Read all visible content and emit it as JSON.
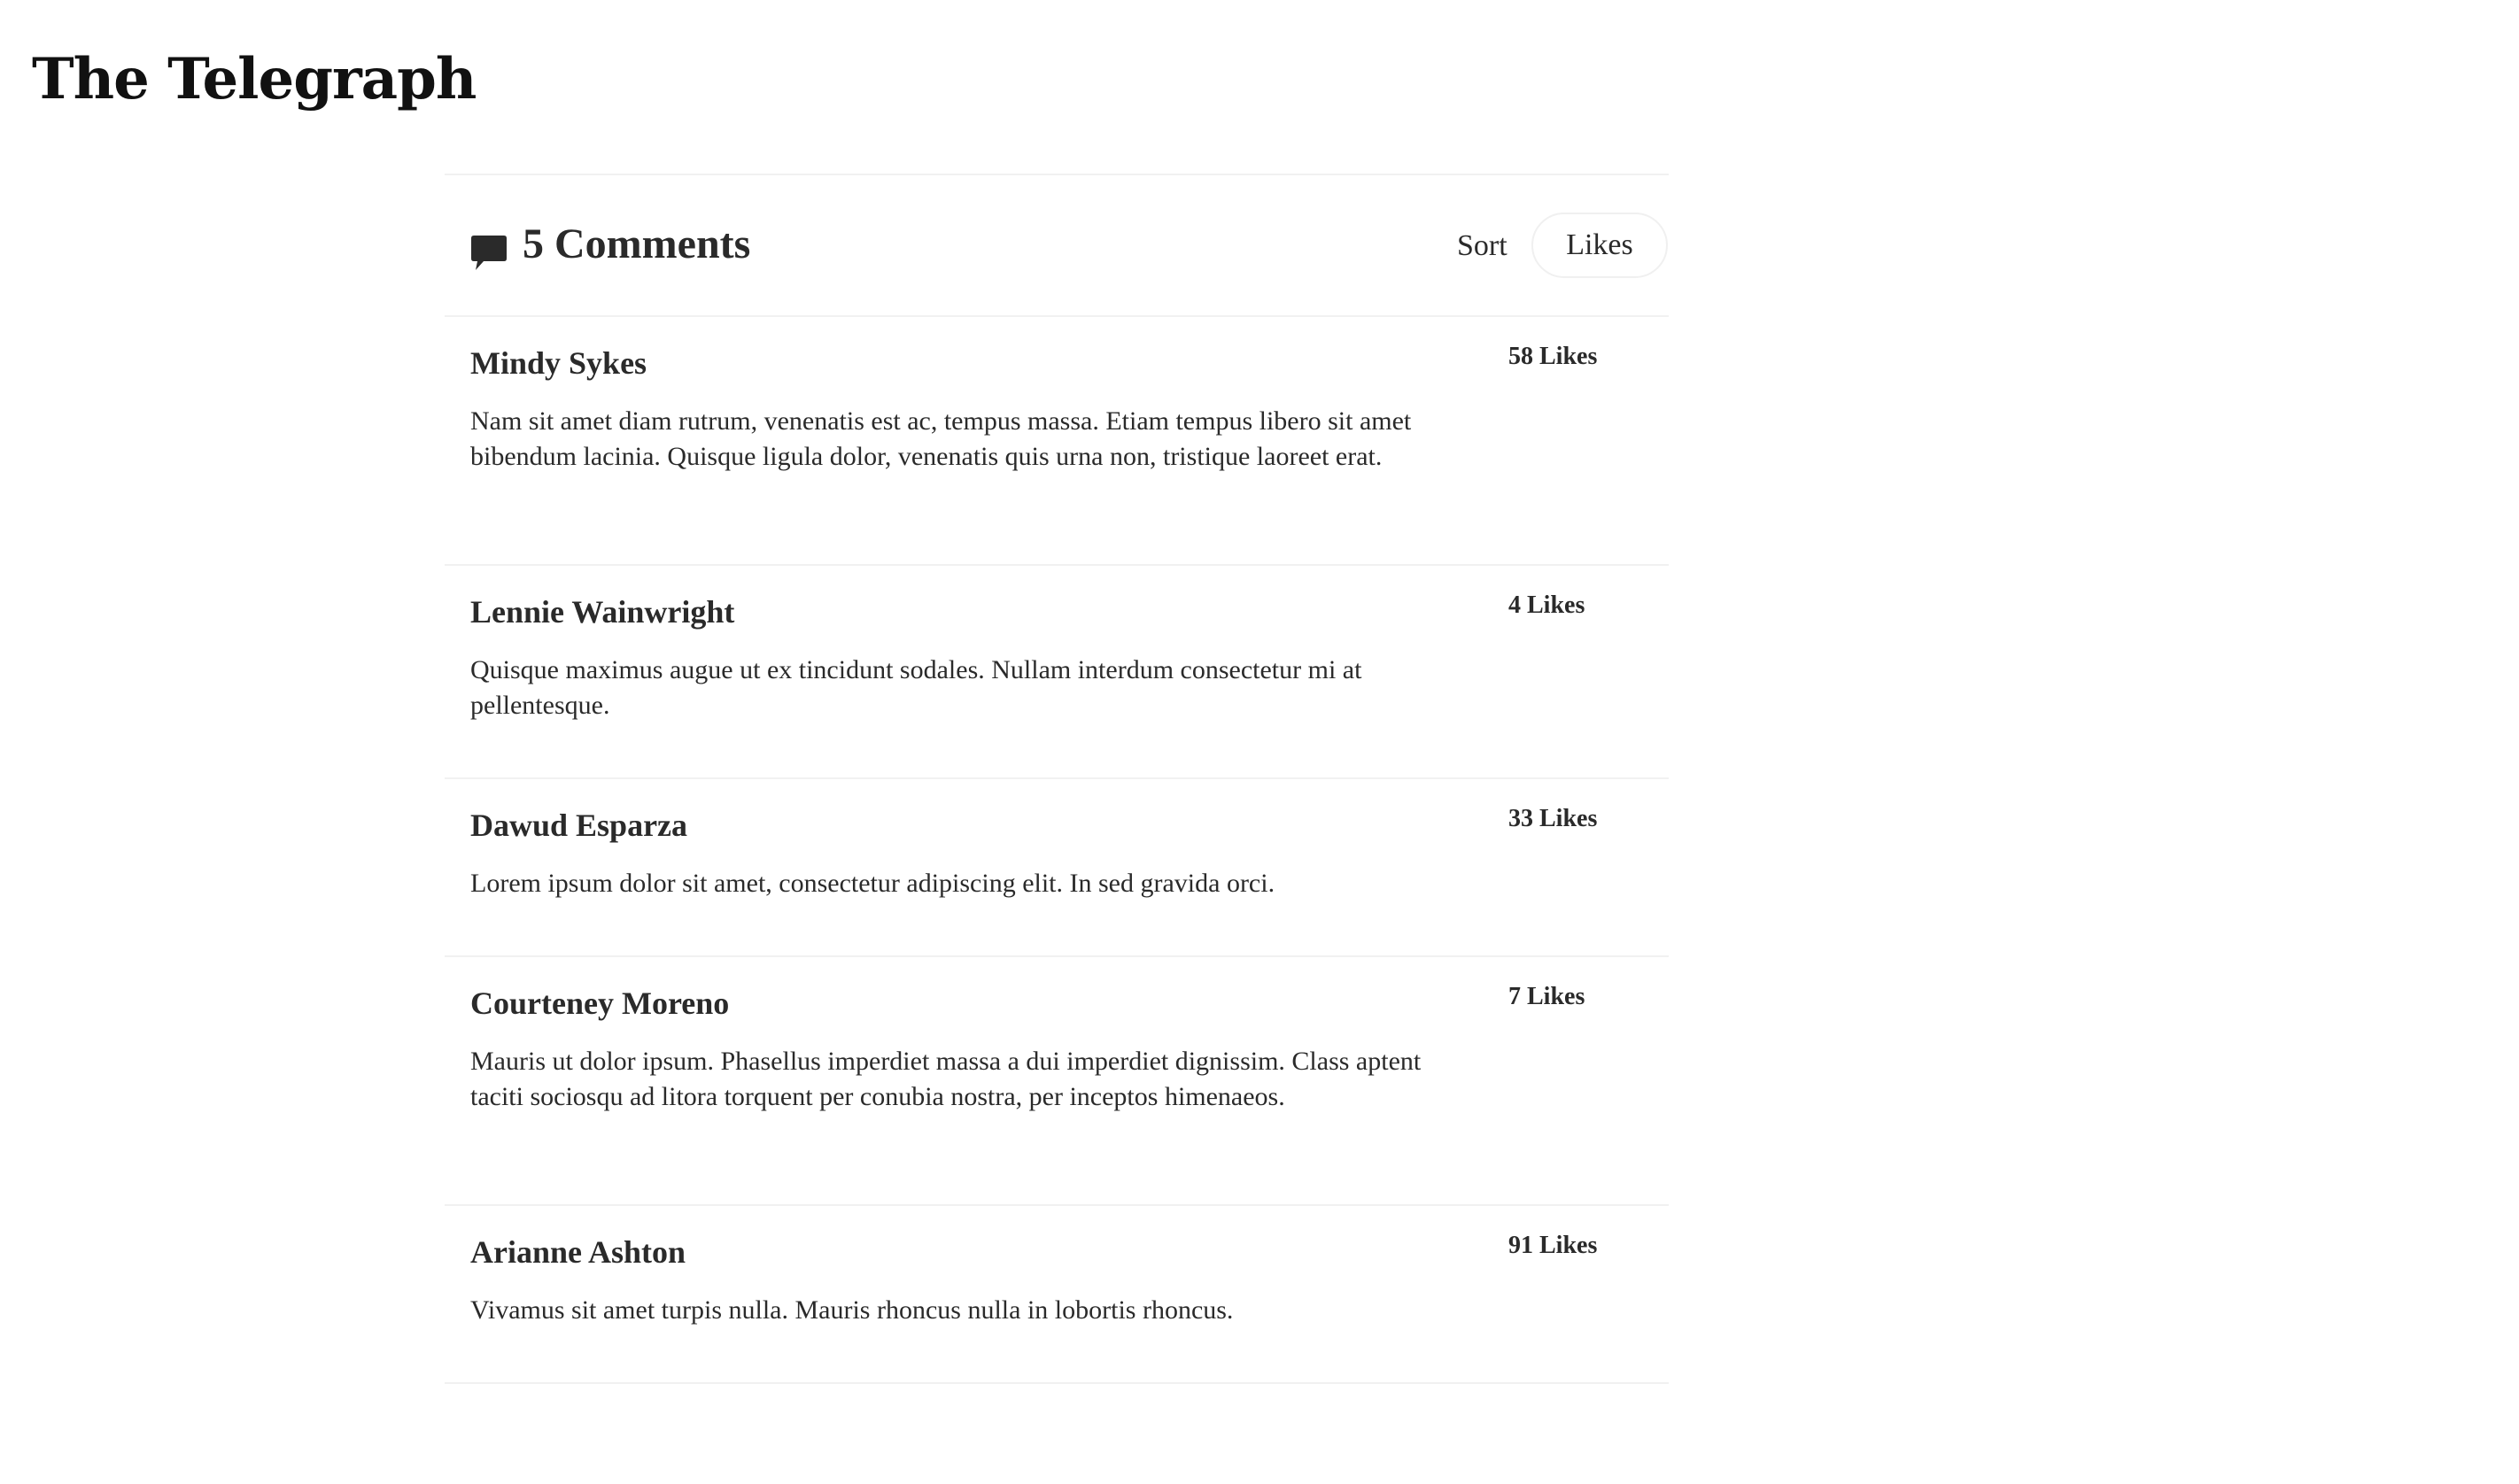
{
  "site": {
    "logo_text": "The Telegraph"
  },
  "comments_header": {
    "icon": "comment-icon",
    "title": "5 Comments",
    "sort_label": "Sort",
    "sort_value": "Likes"
  },
  "comments": [
    {
      "author": "Mindy Sykes",
      "likes": "58 Likes",
      "text": "Nam sit amet diam rutrum, venenatis est ac, tempus massa. Etiam tempus libero sit amet bibendum lacinia. Quisque ligula dolor, venenatis quis urna non, tristique laoreet erat."
    },
    {
      "author": "Lennie Wainwright",
      "likes": "4 Likes",
      "text": "Quisque maximus augue ut ex tincidunt sodales. Nullam interdum consectetur mi at pellentesque."
    },
    {
      "author": "Dawud Esparza",
      "likes": "33 Likes",
      "text": "Lorem ipsum dolor sit amet, consectetur adipiscing elit. In sed gravida orci."
    },
    {
      "author": "Courteney Moreno",
      "likes": "7 Likes",
      "text": "Mauris ut dolor ipsum. Phasellus imperdiet massa a dui imperdiet dignissim. Class aptent taciti sociosqu ad litora torquent per conubia nostra, per inceptos himenaeos."
    },
    {
      "author": "Arianne Ashton",
      "likes": "91 Likes",
      "text": "Vivamus sit amet turpis nulla. Mauris rhoncus nulla in lobortis rhoncus."
    }
  ],
  "colors": {
    "text": "#2a2a2a",
    "divider": "#f1f1f1",
    "background": "#ffffff"
  }
}
